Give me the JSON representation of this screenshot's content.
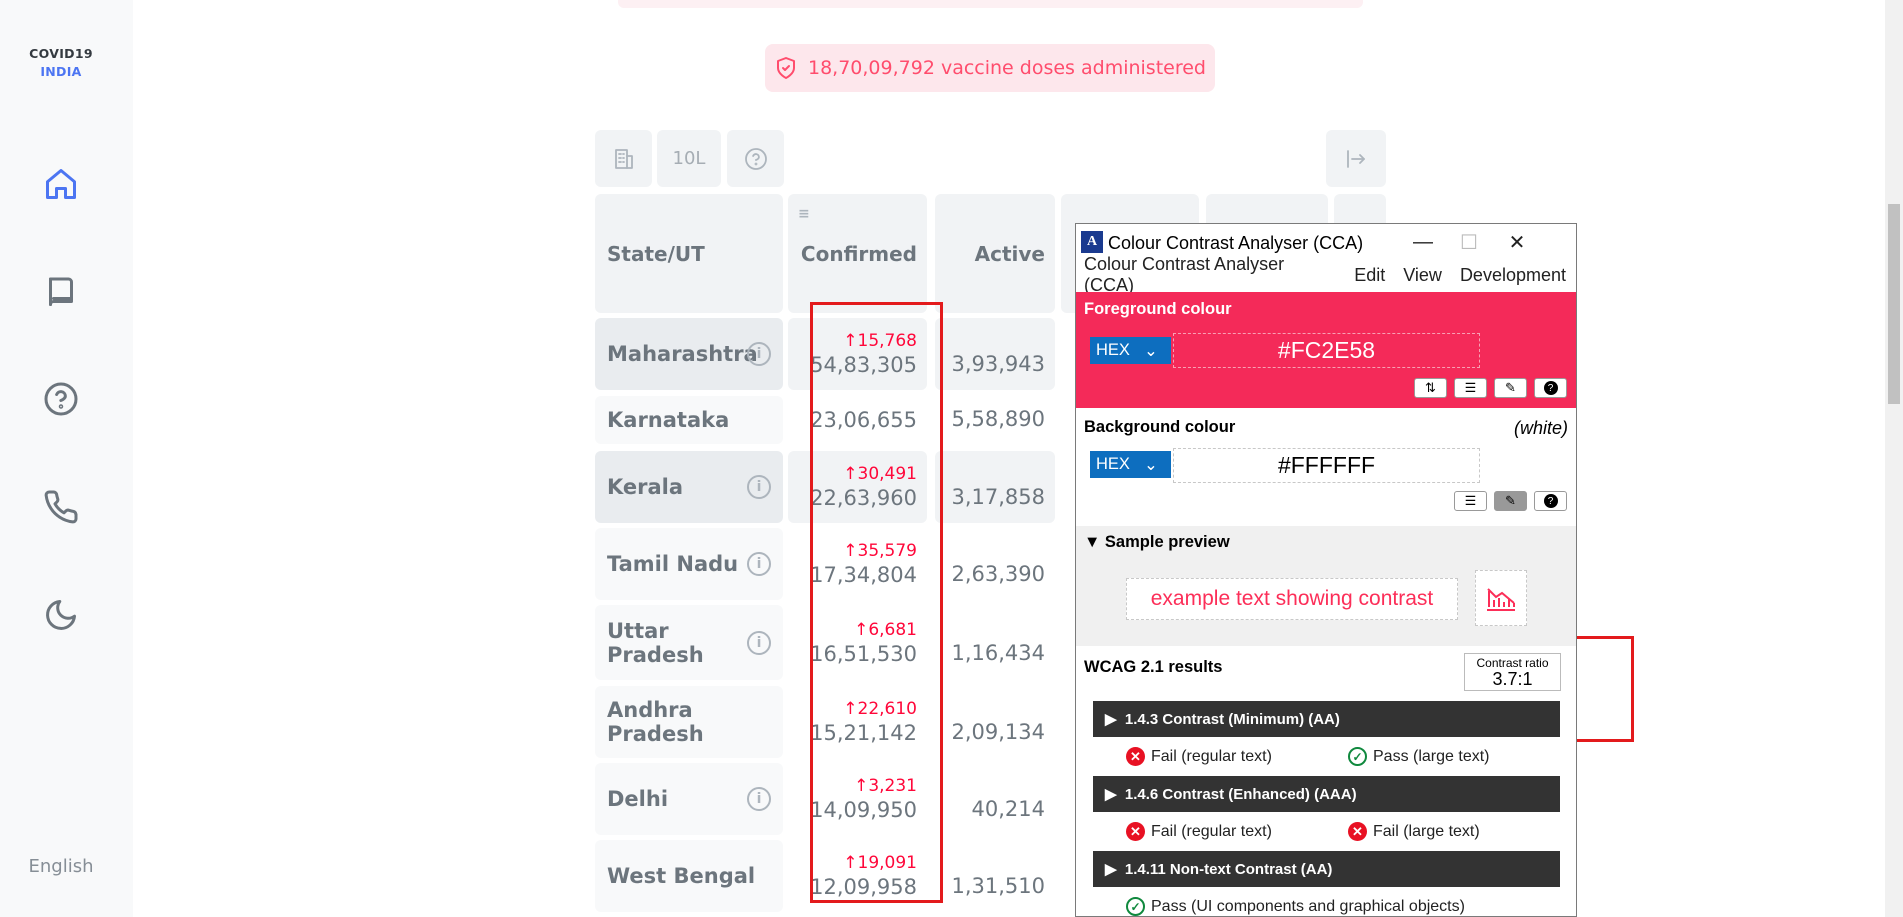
{
  "app": {
    "logo_line1": "COVID19",
    "logo_line2": "INDIA",
    "language": "English"
  },
  "vaccine_banner": {
    "text": "18,70,09,792 vaccine doses administered",
    "icon": "shield-check-icon"
  },
  "toolbar": {
    "district_button_icon": "building-icon",
    "per_capita_label": "10L",
    "help_icon": "question-circle-icon",
    "expand_icon": "expand-table-icon"
  },
  "table": {
    "headers": {
      "state": "State/UT",
      "confirmed": "Confirmed",
      "active": "Active"
    },
    "rows": [
      {
        "state": "Maharashtra",
        "delta": "↑15,768",
        "confirmed": "54,83,305",
        "active": "3,93,943",
        "info": true
      },
      {
        "state": "Karnataka",
        "delta": "",
        "confirmed": "23,06,655",
        "active": "5,58,890",
        "info": false
      },
      {
        "state": "Kerala",
        "delta": "↑30,491",
        "confirmed": "22,63,960",
        "active": "3,17,858",
        "info": true
      },
      {
        "state": "Tamil Nadu",
        "delta": "↑35,579",
        "confirmed": "17,34,804",
        "active": "2,63,390",
        "info": true
      },
      {
        "state": "Uttar Pradesh",
        "delta": "↑6,681",
        "confirmed": "16,51,530",
        "active": "1,16,434",
        "info": true
      },
      {
        "state": "Andhra Pradesh",
        "delta": "↑22,610",
        "confirmed": "15,21,142",
        "active": "2,09,134",
        "info": false
      },
      {
        "state": "Delhi",
        "delta": "↑3,231",
        "confirmed": "14,09,950",
        "active": "40,214",
        "info": true
      },
      {
        "state": "West Bengal",
        "delta": "↑19,091",
        "confirmed": "12,09,958",
        "active": "1,31,510",
        "info": false
      }
    ]
  },
  "cca": {
    "title": "Colour Contrast Analyser (CCA)",
    "menu": [
      "Colour Contrast Analyser (CCA)",
      "Edit",
      "View",
      "Development"
    ],
    "foreground": {
      "label": "Foreground colour",
      "format": "HEX",
      "value": "#FC2E58",
      "color": "#FC2E58"
    },
    "background": {
      "label": "Background colour",
      "name": "(white)",
      "format": "HEX",
      "value": "#FFFFFF"
    },
    "preview": {
      "label": "Sample preview",
      "text": "example text showing contrast"
    },
    "wcag": {
      "label": "WCAG 2.1 results",
      "contrast_label": "Contrast ratio",
      "contrast_value": "3.7:1",
      "criteria": [
        {
          "name": "1.4.3 Contrast (Minimum) (AA)",
          "results": [
            {
              "text": "Fail (regular text)",
              "pass": false
            },
            {
              "text": "Pass (large text)",
              "pass": true
            }
          ]
        },
        {
          "name": "1.4.6 Contrast (Enhanced) (AAA)",
          "results": [
            {
              "text": "Fail (regular text)",
              "pass": false
            },
            {
              "text": "Fail (large text)",
              "pass": false
            }
          ]
        },
        {
          "name": "1.4.11 Non-text Contrast (AA)",
          "results": [
            {
              "text": "Pass (UI components and graphical objects)",
              "pass": true
            }
          ]
        }
      ]
    }
  }
}
